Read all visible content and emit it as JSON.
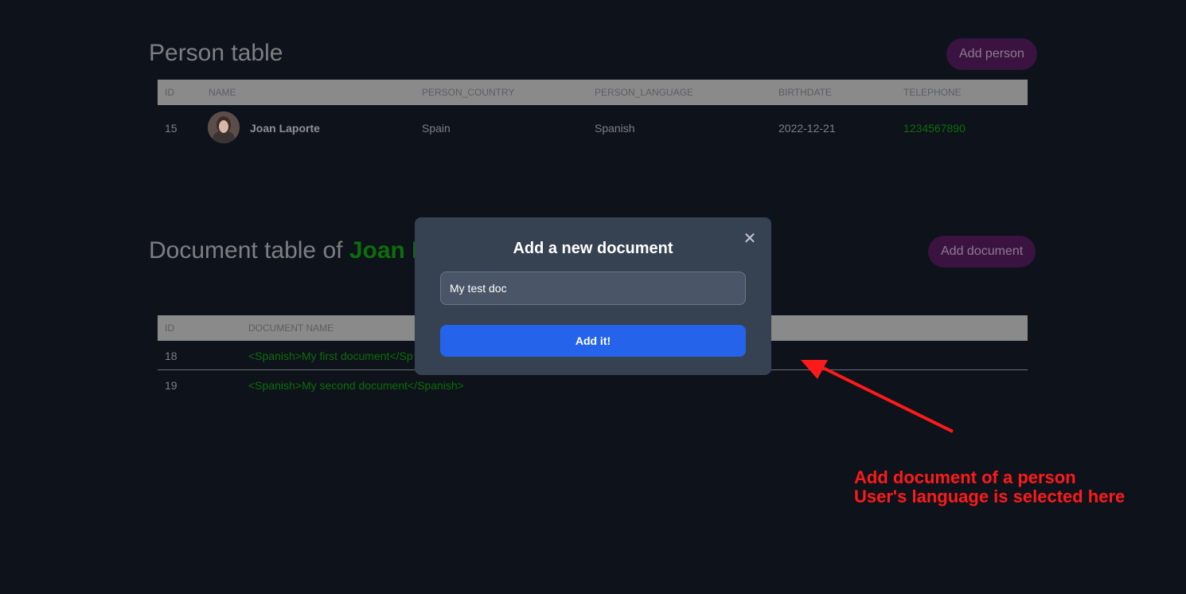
{
  "person_section": {
    "title": "Person table",
    "add_button": "Add person",
    "columns": [
      "ID",
      "NAME",
      "PERSON_COUNTRY",
      "PERSON_LANGUAGE",
      "BIRTHDATE",
      "TELEPHONE"
    ],
    "rows": [
      {
        "id": "15",
        "name": "Joan Laporte",
        "country": "Spain",
        "language": "Spanish",
        "birthdate": "2022-12-21",
        "telephone": "1234567890"
      }
    ]
  },
  "document_section": {
    "title_prefix": "Document table of ",
    "title_person": "Joan L",
    "add_button": "Add document",
    "columns": [
      "ID",
      "DOCUMENT NAME"
    ],
    "rows": [
      {
        "id": "18",
        "name": "<Spanish>My first document</Sp"
      },
      {
        "id": "19",
        "name": "<Spanish>My second document</Spanish>"
      }
    ]
  },
  "modal": {
    "title": "Add a new document",
    "close_glyph": "✕",
    "input_value": "My test doc",
    "submit_label": "Add it!"
  },
  "annotation": {
    "line1": "Add document of a person",
    "line2": "User's language is selected here",
    "color": "#ff1a1a"
  },
  "colors": {
    "background": "#0e121a",
    "accent_green": "#0b6e0b",
    "pill_purple": "#3a1340",
    "modal_bg": "#364152",
    "primary_blue": "#2563eb"
  }
}
